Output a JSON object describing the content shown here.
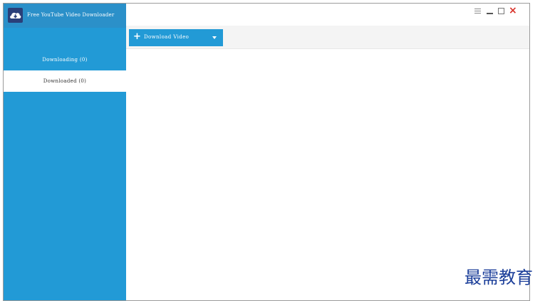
{
  "app": {
    "title": "Free YouTube Video Downloader",
    "logo_icon": "cloud-download-icon"
  },
  "sidebar": {
    "items": [
      {
        "label": "Downloading (0)",
        "active": false
      },
      {
        "label": "Downloaded (0)",
        "active": true
      }
    ]
  },
  "titlebar": {
    "controls": [
      "menu-icon",
      "minimize-icon",
      "maximize-icon",
      "close-icon"
    ]
  },
  "toolbar": {
    "download_button_label": "Download Video",
    "download_button_icon": "plus-icon",
    "dropdown_icon": "caret-down-icon"
  },
  "watermark": {
    "text": "最需教育"
  },
  "colors": {
    "sidebar": "#229ad6",
    "header": "#2b90c9",
    "button": "#229ad6",
    "close": "#d9322a",
    "watermark": "#1c3f9a"
  }
}
